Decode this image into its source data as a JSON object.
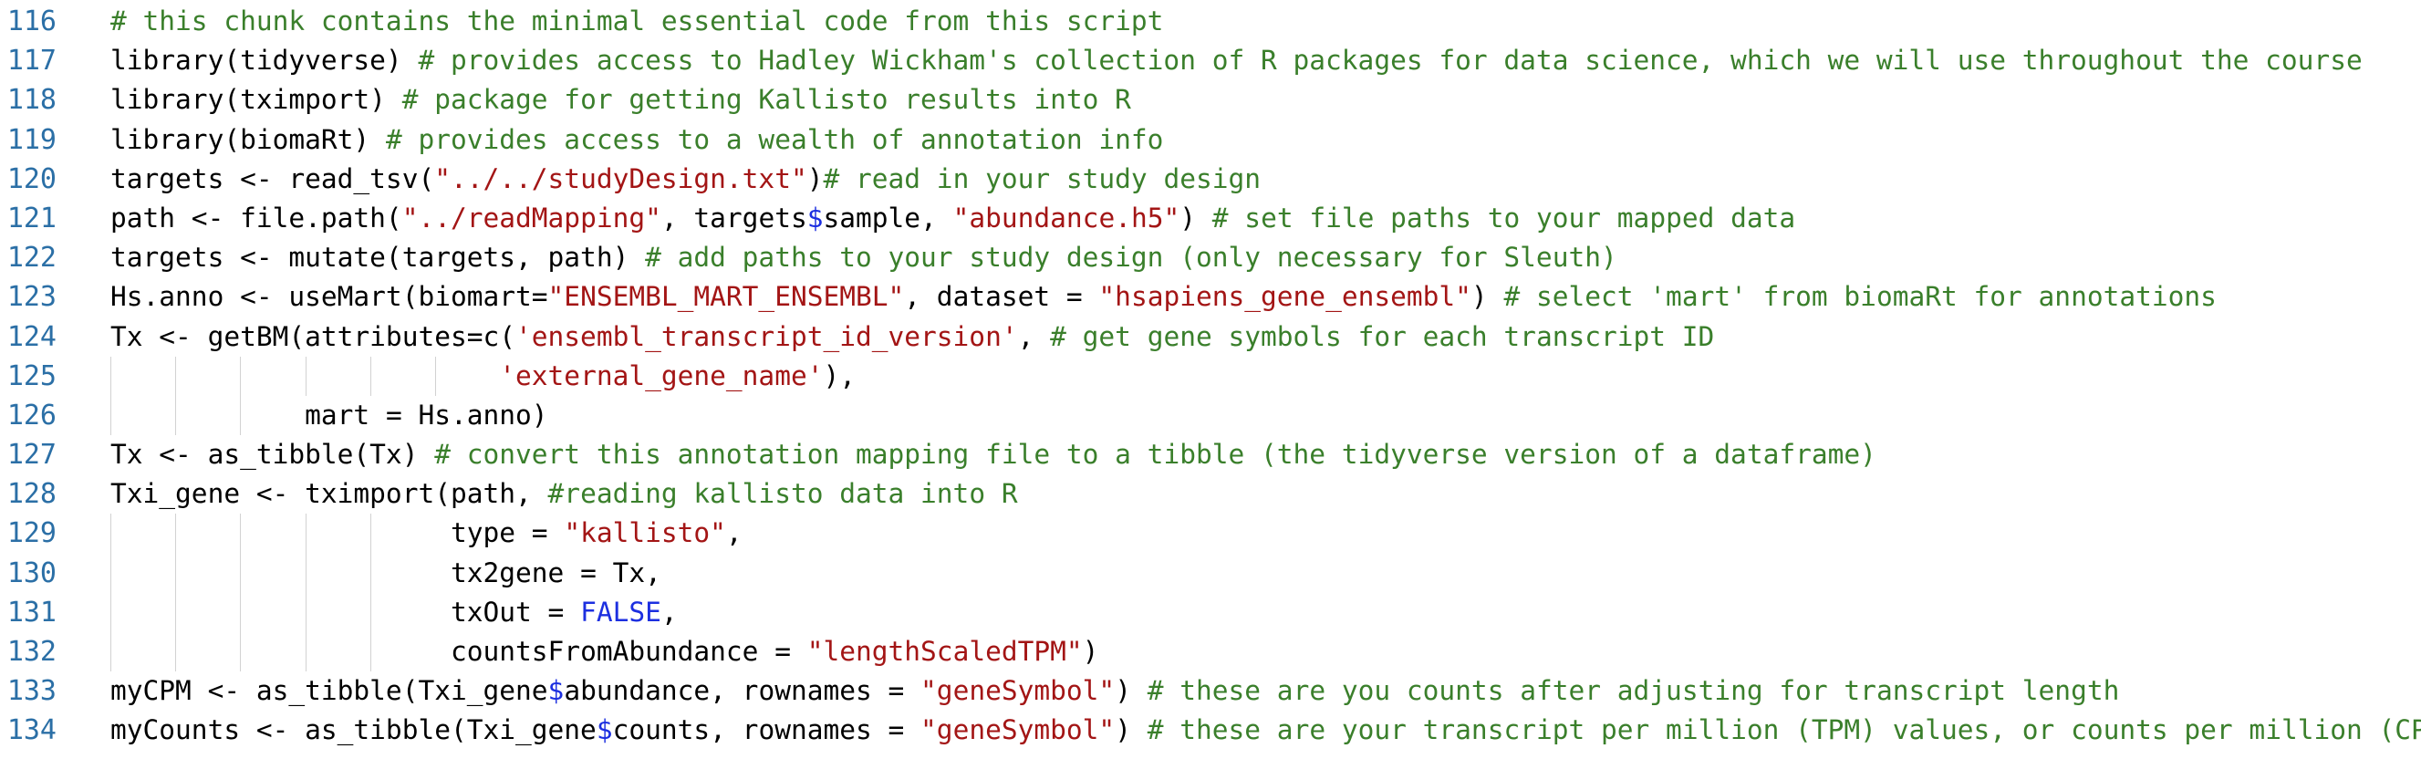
{
  "colors": {
    "line_number": "#2b6fa6",
    "comment": "#3a7f2b",
    "string": "#a31515",
    "keyword": "#1c2fe0",
    "text": "#000000",
    "indent_guide": "#d2d2d2",
    "background": "#ffffff"
  },
  "lines": [
    {
      "no": "116",
      "code": "",
      "segs": [
        {
          "t": "cmt",
          "v": "# this chunk contains the minimal essential code from this script"
        }
      ]
    },
    {
      "no": "117",
      "segs": [
        {
          "t": "txt",
          "v": "library(tidyverse) "
        },
        {
          "t": "cmt",
          "v": "# provides access to Hadley Wickham's collection of R packages for data science, which we will use throughout the course"
        }
      ]
    },
    {
      "no": "118",
      "segs": [
        {
          "t": "txt",
          "v": "library(tximport) "
        },
        {
          "t": "cmt",
          "v": "# package for getting Kallisto results into R"
        }
      ]
    },
    {
      "no": "119",
      "segs": [
        {
          "t": "txt",
          "v": "library(biomaRt) "
        },
        {
          "t": "cmt",
          "v": "# provides access to a wealth of annotation info"
        }
      ]
    },
    {
      "no": "120",
      "segs": [
        {
          "t": "txt",
          "v": "targets <- read_tsv("
        },
        {
          "t": "str",
          "v": "\"../../studyDesign.txt\""
        },
        {
          "t": "txt",
          "v": ")"
        },
        {
          "t": "cmt",
          "v": "# read in your study design"
        }
      ]
    },
    {
      "no": "121",
      "segs": [
        {
          "t": "txt",
          "v": "path <- file.path("
        },
        {
          "t": "str",
          "v": "\"../readMapping\""
        },
        {
          "t": "txt",
          "v": ", targets"
        },
        {
          "t": "op",
          "v": "$"
        },
        {
          "t": "txt",
          "v": "sample, "
        },
        {
          "t": "str",
          "v": "\"abundance.h5\""
        },
        {
          "t": "txt",
          "v": ") "
        },
        {
          "t": "cmt",
          "v": "# set file paths to your mapped data"
        }
      ]
    },
    {
      "no": "122",
      "segs": [
        {
          "t": "txt",
          "v": "targets <- mutate(targets, path) "
        },
        {
          "t": "cmt",
          "v": "# add paths to your study design (only necessary for Sleuth)"
        }
      ]
    },
    {
      "no": "123",
      "segs": [
        {
          "t": "txt",
          "v": "Hs.anno <- useMart(biomart="
        },
        {
          "t": "str",
          "v": "\"ENSEMBL_MART_ENSEMBL\""
        },
        {
          "t": "txt",
          "v": ", dataset = "
        },
        {
          "t": "str",
          "v": "\"hsapiens_gene_ensembl\""
        },
        {
          "t": "txt",
          "v": ") "
        },
        {
          "t": "cmt",
          "v": "# select 'mart' from biomaRt for annotations"
        }
      ]
    },
    {
      "no": "124",
      "segs": [
        {
          "t": "txt",
          "v": "Tx <- getBM(attributes=c("
        },
        {
          "t": "str",
          "v": "'ensembl_transcript_id_version'"
        },
        {
          "t": "txt",
          "v": ", "
        },
        {
          "t": "cmt",
          "v": "# get gene symbols for each transcript ID"
        }
      ]
    },
    {
      "no": "125",
      "indent": "                        ",
      "guides": 6,
      "segs": [
        {
          "t": "str",
          "v": "'external_gene_name'"
        },
        {
          "t": "txt",
          "v": "),"
        }
      ]
    },
    {
      "no": "126",
      "indent": "            ",
      "guides": 3,
      "segs": [
        {
          "t": "txt",
          "v": "mart = Hs.anno)"
        }
      ]
    },
    {
      "no": "127",
      "segs": [
        {
          "t": "txt",
          "v": "Tx <- as_tibble(Tx) "
        },
        {
          "t": "cmt",
          "v": "# convert this annotation mapping file to a tibble (the tidyverse version of a dataframe)"
        }
      ]
    },
    {
      "no": "128",
      "segs": [
        {
          "t": "txt",
          "v": "Txi_gene <- tximport(path, "
        },
        {
          "t": "cmt",
          "v": "#reading kallisto data into R"
        }
      ]
    },
    {
      "no": "129",
      "indent": "                     ",
      "guides": 5,
      "segs": [
        {
          "t": "txt",
          "v": "type = "
        },
        {
          "t": "str",
          "v": "\"kallisto\""
        },
        {
          "t": "txt",
          "v": ","
        }
      ]
    },
    {
      "no": "130",
      "indent": "                     ",
      "guides": 5,
      "segs": [
        {
          "t": "txt",
          "v": "tx2gene = Tx,"
        }
      ]
    },
    {
      "no": "131",
      "indent": "                     ",
      "guides": 5,
      "segs": [
        {
          "t": "txt",
          "v": "txOut = "
        },
        {
          "t": "kw",
          "v": "FALSE"
        },
        {
          "t": "txt",
          "v": ","
        }
      ]
    },
    {
      "no": "132",
      "indent": "                     ",
      "guides": 5,
      "segs": [
        {
          "t": "txt",
          "v": "countsFromAbundance = "
        },
        {
          "t": "str",
          "v": "\"lengthScaledTPM\""
        },
        {
          "t": "txt",
          "v": ")"
        }
      ]
    },
    {
      "no": "133",
      "segs": [
        {
          "t": "txt",
          "v": "myCPM <- as_tibble(Txi_gene"
        },
        {
          "t": "op",
          "v": "$"
        },
        {
          "t": "txt",
          "v": "abundance, rownames = "
        },
        {
          "t": "str",
          "v": "\"geneSymbol\""
        },
        {
          "t": "txt",
          "v": ") "
        },
        {
          "t": "cmt",
          "v": "# these are you counts after adjusting for transcript length"
        }
      ]
    },
    {
      "no": "134",
      "segs": [
        {
          "t": "txt",
          "v": "myCounts <- as_tibble(Txi_gene"
        },
        {
          "t": "op",
          "v": "$"
        },
        {
          "t": "txt",
          "v": "counts, rownames = "
        },
        {
          "t": "str",
          "v": "\"geneSymbol\""
        },
        {
          "t": "txt",
          "v": ") "
        },
        {
          "t": "cmt",
          "v": "# these are your transcript per million (TPM) values, or counts per million (CPM)"
        }
      ]
    }
  ]
}
